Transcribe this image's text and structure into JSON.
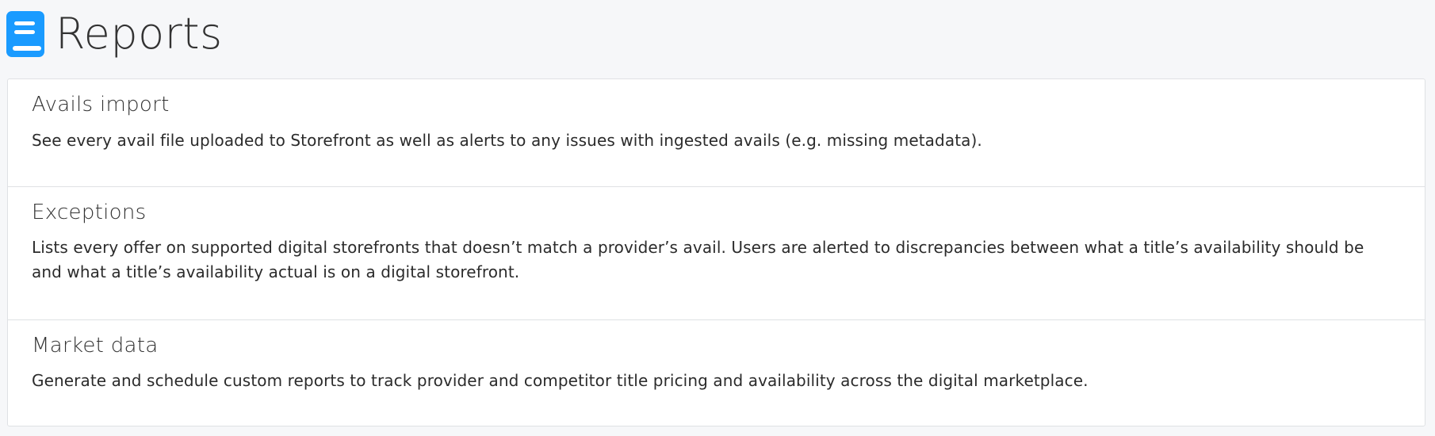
{
  "header": {
    "icon": "book-icon",
    "title": "Reports"
  },
  "colors": {
    "accent": "#1a9bff",
    "background": "#f6f7f9",
    "card": "#ffffff",
    "border": "#dfe1e4"
  },
  "reports": [
    {
      "title": "Avails import",
      "description": "See every avail file uploaded to Storefront as well as alerts to any issues with ingested avails (e.g. missing metadata)."
    },
    {
      "title": "Exceptions",
      "description": "Lists every offer on supported digital storefronts that doesn’t match a provider’s avail. Users are alerted to discrepancies between what a title’s availability should be and what a title’s availability actual is on a digital storefront."
    },
    {
      "title": "Market data",
      "description": "Generate and schedule custom reports to track provider and competitor title pricing and availability across the digital marketplace."
    }
  ]
}
